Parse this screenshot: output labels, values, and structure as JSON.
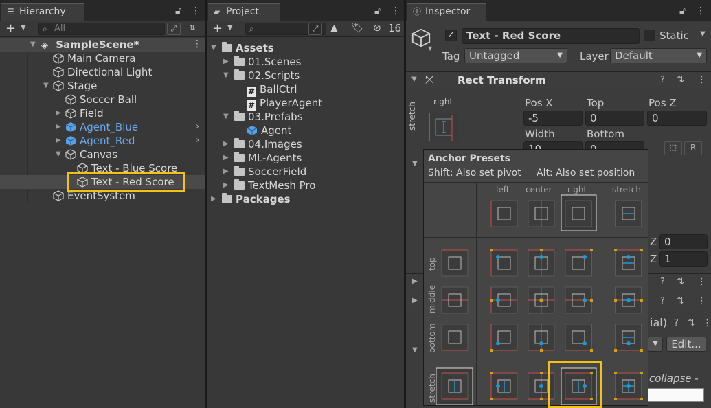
{
  "hierarchy": {
    "tab_label": "Hierarchy",
    "search_placeholder": "All",
    "scene": "SampleScene*",
    "items": [
      {
        "label": "Main Camera"
      },
      {
        "label": "Directional Light"
      },
      {
        "label": "Stage"
      },
      {
        "label": "Soccer Ball"
      },
      {
        "label": "Field"
      },
      {
        "label": "Agent_Blue"
      },
      {
        "label": "Agent_Red"
      },
      {
        "label": "Canvas"
      },
      {
        "label": "Text - Blue Score"
      },
      {
        "label": "Text - Red Score"
      },
      {
        "label": "EventSystem"
      }
    ]
  },
  "project": {
    "tab_label": "Project",
    "search_placeholder": "",
    "hidden_count": "16",
    "items": [
      {
        "label": "Assets"
      },
      {
        "label": "01.Scenes"
      },
      {
        "label": "02.Scripts"
      },
      {
        "label": "BallCtrl"
      },
      {
        "label": "PlayerAgent"
      },
      {
        "label": "03.Prefabs"
      },
      {
        "label": "Agent"
      },
      {
        "label": "04.Images"
      },
      {
        "label": "ML-Agents"
      },
      {
        "label": "SoccerField"
      },
      {
        "label": "TextMesh Pro"
      },
      {
        "label": "Packages"
      }
    ]
  },
  "inspector": {
    "tab_label": "Inspector",
    "object_name": "Text - Red Score",
    "static_label": "Static",
    "tag_label": "Tag",
    "tag_value": "Untagged",
    "layer_label": "Layer",
    "layer_value": "Default",
    "rect_transform": {
      "title": "Rect Transform",
      "anchor_h": "right",
      "anchor_v": "stretch",
      "pos_x_label": "Pos X",
      "pos_x": "-5",
      "top_label": "Top",
      "top": "0",
      "pos_z_label": "Pos Z",
      "pos_z": "0",
      "width_label": "Width",
      "width": "10",
      "bottom_label": "Bottom",
      "bottom": "0",
      "r_button": "R"
    },
    "scale_z_label": "Z",
    "scale_z_1": "0",
    "scale_z_2": "1",
    "material_fragment": "ial)",
    "edit_button": "Edit...",
    "collapse_label": "collapse -"
  },
  "anchor_presets": {
    "title": "Anchor Presets",
    "shift_hint": "Shift: Also set pivot",
    "alt_hint": "Alt: Also set position",
    "columns": [
      "left",
      "center",
      "right",
      "stretch"
    ],
    "rows": [
      "top",
      "middle",
      "bottom",
      "stretch"
    ]
  },
  "colors": {
    "highlight": "#f2c314",
    "anchor_dot": "#1c9ad6",
    "anchor_frame_red": "#c4504a",
    "prefab_blue": "#6ea6e8"
  }
}
